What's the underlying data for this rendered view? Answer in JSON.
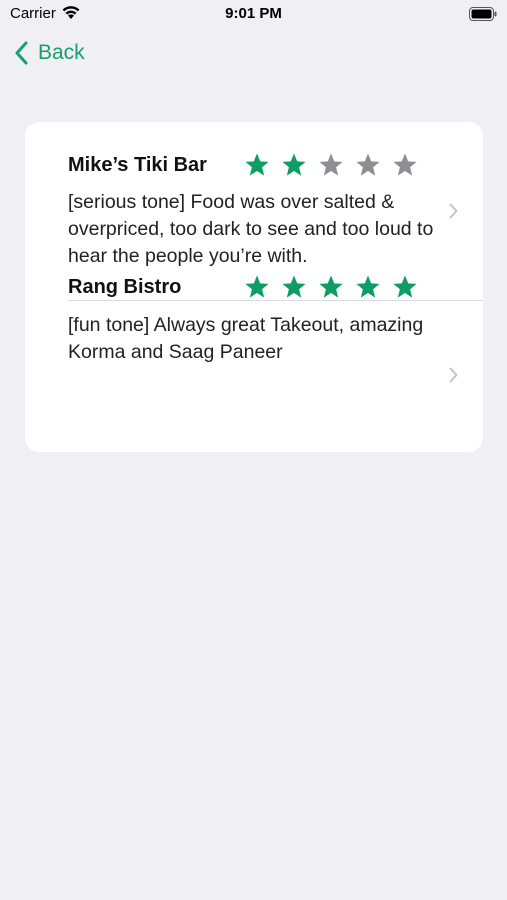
{
  "status_bar": {
    "carrier": "Carrier",
    "time": "9:01 PM"
  },
  "nav": {
    "back_label": "Back",
    "accent_color": "#1aa06a"
  },
  "reviews": [
    {
      "name": "Mike’s Tiki Bar",
      "rating": 2,
      "max_rating": 5,
      "text": "[serious tone] Food was over salted & overpriced, too dark to see and too loud to hear the people you’re with."
    },
    {
      "name": "Rang Bistro",
      "rating": 5,
      "max_rating": 5,
      "text": "[fun tone] Always great Takeout, amazing Korma and Saag Paneer"
    }
  ],
  "colors": {
    "star_filled": "#0f9d63",
    "star_empty": "#8e8e93",
    "background": "#efeff4"
  }
}
